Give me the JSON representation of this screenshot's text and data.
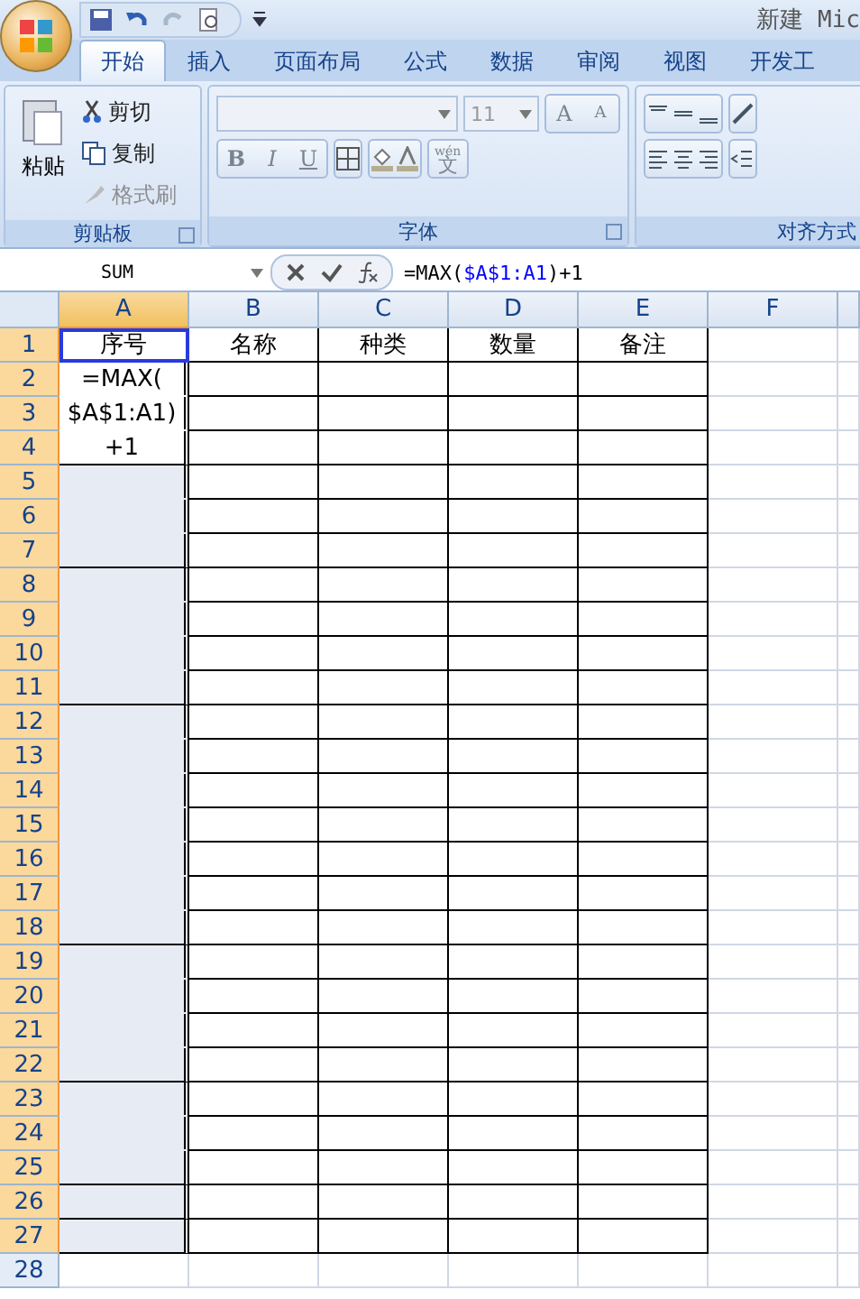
{
  "window": {
    "title": "新建 Mic"
  },
  "tabs": [
    {
      "label": "开始",
      "selected": true
    },
    {
      "label": "插入",
      "selected": false
    },
    {
      "label": "页面布局",
      "selected": false
    },
    {
      "label": "公式",
      "selected": false
    },
    {
      "label": "数据",
      "selected": false
    },
    {
      "label": "审阅",
      "selected": false
    },
    {
      "label": "视图",
      "selected": false
    },
    {
      "label": "开发工",
      "selected": false
    }
  ],
  "clipboard": {
    "label": "剪贴板",
    "paste": "粘贴",
    "cut": "剪切",
    "copy": "复制",
    "format_painter": "格式刷"
  },
  "font": {
    "label": "字体",
    "size": "11",
    "grow": "A",
    "shrink": "A",
    "bold": "B",
    "italic": "I",
    "underline": "U",
    "phonetic_top": "wén",
    "phonetic_bottom": "文"
  },
  "alignment": {
    "label": "对齐方式"
  },
  "name_box": "SUM",
  "formula_parts": [
    {
      "text": "=MAX(",
      "ref": false
    },
    {
      "text": "$A$1:A1",
      "ref": true
    },
    {
      "text": ")+1",
      "ref": false
    }
  ],
  "columns": [
    {
      "label": "A",
      "selected": true
    },
    {
      "label": "B",
      "selected": false
    },
    {
      "label": "C",
      "selected": false
    },
    {
      "label": "D",
      "selected": false
    },
    {
      "label": "E",
      "selected": false
    },
    {
      "label": "F",
      "selected": false
    }
  ],
  "header_row": [
    "序号",
    "名称",
    "种类",
    "数量",
    "备注"
  ],
  "rows": [
    {
      "number": "1",
      "selected": true
    },
    {
      "number": "2",
      "selected": true,
      "a_text": "=MAX(",
      "a_active": true,
      "a_joined": true
    },
    {
      "number": "3",
      "selected": true,
      "a_text": "$A$1:A1)",
      "a_active": true,
      "a_joined": true
    },
    {
      "number": "4",
      "selected": true,
      "a_text": "+1",
      "a_active": true,
      "a_joined": false
    },
    {
      "number": "5",
      "selected": true,
      "a_active": false,
      "a_joined": true
    },
    {
      "number": "6",
      "selected": true,
      "a_active": false,
      "a_joined": true
    },
    {
      "number": "7",
      "selected": true,
      "a_active": false,
      "a_joined": false
    },
    {
      "number": "8",
      "selected": true,
      "a_active": false,
      "a_joined": true
    },
    {
      "number": "9",
      "selected": true,
      "a_active": false,
      "a_joined": true
    },
    {
      "number": "10",
      "selected": true,
      "a_active": false,
      "a_joined": true
    },
    {
      "number": "11",
      "selected": true,
      "a_active": false,
      "a_joined": false
    },
    {
      "number": "12",
      "selected": true,
      "a_active": false,
      "a_joined": true
    },
    {
      "number": "13",
      "selected": true,
      "a_active": false,
      "a_joined": true
    },
    {
      "number": "14",
      "selected": true,
      "a_active": false,
      "a_joined": true
    },
    {
      "number": "15",
      "selected": true,
      "a_active": false,
      "a_joined": true
    },
    {
      "number": "16",
      "selected": true,
      "a_active": false,
      "a_joined": true
    },
    {
      "number": "17",
      "selected": true,
      "a_active": false,
      "a_joined": true
    },
    {
      "number": "18",
      "selected": true,
      "a_active": false,
      "a_joined": false
    },
    {
      "number": "19",
      "selected": true,
      "a_active": false,
      "a_joined": true
    },
    {
      "number": "20",
      "selected": true,
      "a_active": false,
      "a_joined": true
    },
    {
      "number": "21",
      "selected": true,
      "a_active": false,
      "a_joined": true
    },
    {
      "number": "22",
      "selected": true,
      "a_active": false,
      "a_joined": false
    },
    {
      "number": "23",
      "selected": true,
      "a_active": false,
      "a_joined": true
    },
    {
      "number": "24",
      "selected": true,
      "a_active": false,
      "a_joined": true
    },
    {
      "number": "25",
      "selected": true,
      "a_active": false,
      "a_joined": false
    },
    {
      "number": "26",
      "selected": true,
      "a_active": false,
      "a_joined": false
    },
    {
      "number": "27",
      "selected": true,
      "a_active": false,
      "a_joined": false
    },
    {
      "number": "28",
      "selected": false
    }
  ]
}
